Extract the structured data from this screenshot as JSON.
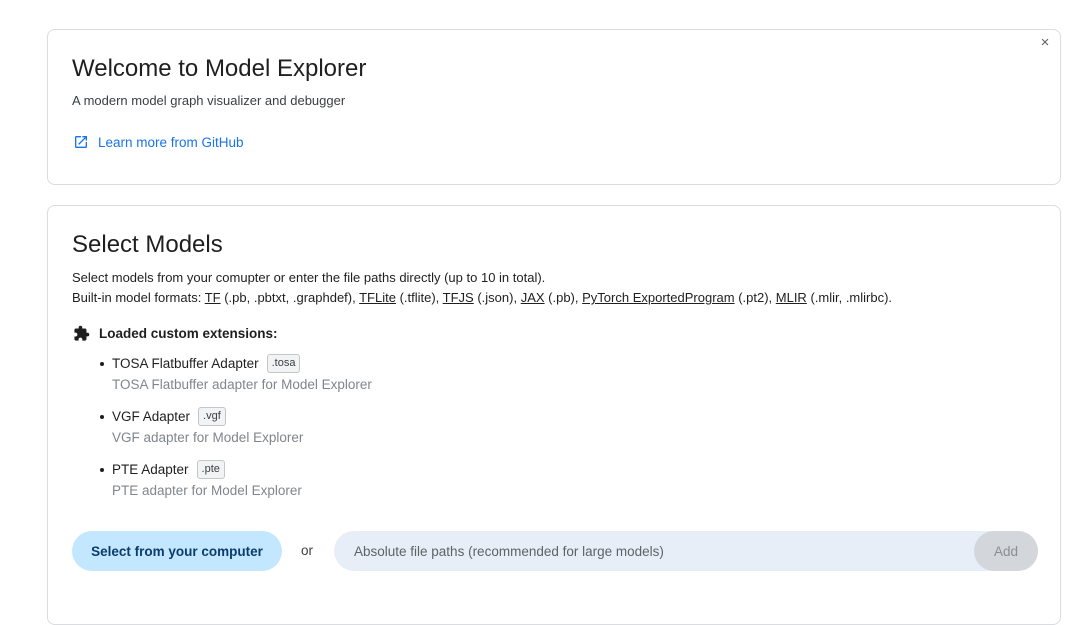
{
  "welcome": {
    "close_icon": "×",
    "title": "Welcome to Model Explorer",
    "subtitle": "A modern model graph visualizer and debugger",
    "github_link": "Learn more from GitHub"
  },
  "select": {
    "title": "Select Models",
    "description_line1": "Select models from your comupter or enter the file paths directly (up to 10 in total).",
    "description_line2_prefix": "Built-in model formats: ",
    "formats": [
      {
        "name": "TF",
        "ext": " (.pb, .pbtxt, .graphdef), "
      },
      {
        "name": "TFLite",
        "ext": " (.tflite), "
      },
      {
        "name": "TFJS",
        "ext": " (.json), "
      },
      {
        "name": "JAX",
        "ext": " (.pb), "
      },
      {
        "name": "PyTorch ExportedProgram",
        "ext": " (.pt2), "
      },
      {
        "name": "MLIR",
        "ext": " (.mlir, .mlirbc)."
      }
    ],
    "extensions_header": "Loaded custom extensions:",
    "extensions": [
      {
        "name": "TOSA Flatbuffer Adapter",
        "tag": ".tosa",
        "desc": "TOSA Flatbuffer adapter for Model Explorer"
      },
      {
        "name": "VGF Adapter",
        "tag": ".vgf",
        "desc": "VGF adapter for Model Explorer"
      },
      {
        "name": "PTE Adapter",
        "tag": ".pte",
        "desc": "PTE adapter for Model Explorer"
      }
    ],
    "select_button": "Select from your computer",
    "or_label": "or",
    "path_placeholder": "Absolute file paths (recommended for large models)",
    "add_button": "Add"
  },
  "colors": {
    "accent": "#1a73e8",
    "primary_button_bg": "#c2e7ff",
    "input_bg": "#e8eef7"
  }
}
